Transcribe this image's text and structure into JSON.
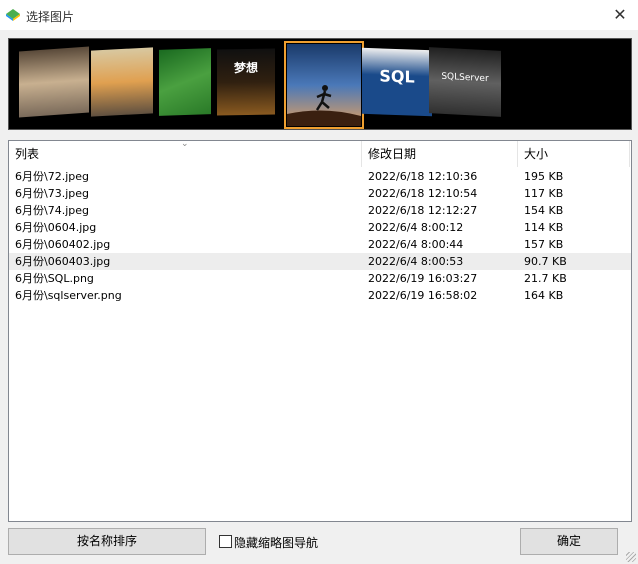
{
  "window": {
    "title": "选择图片",
    "close_icon": "close-icon"
  },
  "thumbnails": [
    {
      "label": ""
    },
    {
      "label": ""
    },
    {
      "label": ""
    },
    {
      "label": "梦想"
    },
    {
      "label": ""
    },
    {
      "label": "SQL"
    },
    {
      "label": "SQLServer"
    }
  ],
  "table": {
    "columns": [
      "列表",
      "修改日期",
      "大小"
    ],
    "rows": [
      {
        "name": "6月份\\72.jpeg",
        "date": "2022/6/18 12:10:36",
        "size": "195 KB"
      },
      {
        "name": "6月份\\73.jpeg",
        "date": "2022/6/18 12:10:54",
        "size": "117 KB"
      },
      {
        "name": "6月份\\74.jpeg",
        "date": "2022/6/18 12:12:27",
        "size": "154 KB"
      },
      {
        "name": "6月份\\0604.jpg",
        "date": "2022/6/4 8:00:12",
        "size": "114 KB"
      },
      {
        "name": "6月份\\060402.jpg",
        "date": "2022/6/4 8:00:44",
        "size": "157 KB"
      },
      {
        "name": "6月份\\060403.jpg",
        "date": "2022/6/4 8:00:53",
        "size": "90.7 KB"
      },
      {
        "name": "6月份\\SQL.png",
        "date": "2022/6/19 16:03:27",
        "size": "21.7 KB"
      },
      {
        "name": "6月份\\sqlserver.png",
        "date": "2022/6/19 16:58:02",
        "size": "164 KB"
      }
    ]
  },
  "footer": {
    "sort_button": "按名称排序",
    "hide_thumbnail_checkbox": "隐藏缩略图导航",
    "ok_button": "确定"
  },
  "colors": {
    "selection_outline": "#f0a030",
    "strip_background": "#000000"
  }
}
